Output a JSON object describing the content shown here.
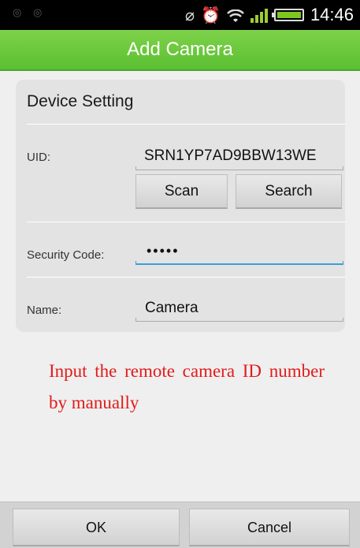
{
  "status_bar": {
    "time": "14:46",
    "notification_icons": [
      "notification-icon",
      "notification-icon"
    ],
    "status_icons": [
      "vibrate-icon",
      "alarm-icon",
      "wifi-icon",
      "signal-icon",
      "battery-icon"
    ],
    "battery_level": 1.0,
    "accent_color": "#9ccc34"
  },
  "title_bar": {
    "title": "Add Camera",
    "color": "#6ccb3c"
  },
  "device_setting": {
    "title": "Device Setting",
    "uid": {
      "label": "UID:",
      "value": "SRN1YP7AD9BBW13WE"
    },
    "scan_label": "Scan",
    "search_label": "Search",
    "security_code": {
      "label": "Security Code:",
      "value": "•••••"
    },
    "name": {
      "label": "Name:",
      "value": "Camera"
    }
  },
  "annotation": {
    "text": "Input the remote camera ID number by manually",
    "color": "#e21b1b"
  },
  "footer": {
    "ok_label": "OK",
    "cancel_label": "Cancel"
  }
}
